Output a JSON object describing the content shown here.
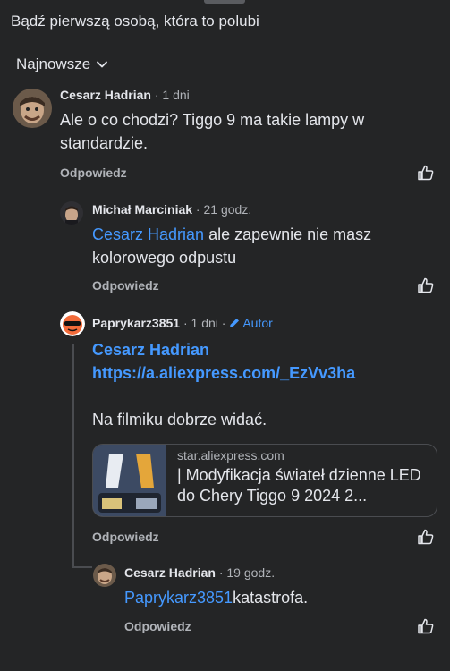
{
  "header": {
    "likes_text": "Bądź pierwszą osobą, która to polubi"
  },
  "sort": {
    "label": "Najnowsze"
  },
  "comments": [
    {
      "author": "Cesarz Hadrian",
      "time": "1 dni",
      "text": "Ale o co chodzi? Tiggo 9 ma takie lampy w standardzie.",
      "reply_label": "Odpowiedz"
    },
    {
      "author": "Michał Marciniak",
      "time": "21 godz.",
      "mention": "Cesarz Hadrian",
      "text": " ale zapewnie nie masz kolorowego odpustu",
      "reply_label": "Odpowiedz"
    },
    {
      "author": "Paprykarz3851",
      "time": "1 dni",
      "badge": "Autor",
      "mention": "Cesarz Hadrian",
      "link": "https://a.aliexpress.com/_EzVv3ha",
      "text": "Na filmiku dobrze widać.",
      "preview": {
        "domain": "star.aliexpress.com",
        "title": "| Modyfikacja świateł dzienne LED do Chery Tiggo 9 2024 2..."
      },
      "reply_label": "Odpowiedz"
    },
    {
      "author": "Cesarz Hadrian",
      "time": "19 godz.",
      "mention": "Paprykarz3851",
      "text": "katastrofa.",
      "reply_label": "Odpowiedz"
    }
  ],
  "separator": " · ",
  "icons": {
    "chevron": "chevron-down-icon",
    "like": "thumbs-up-icon",
    "pencil": "pencil-icon"
  },
  "colors": {
    "background": "#242526",
    "accent": "#4599ff",
    "muted": "#b0b3b8"
  }
}
